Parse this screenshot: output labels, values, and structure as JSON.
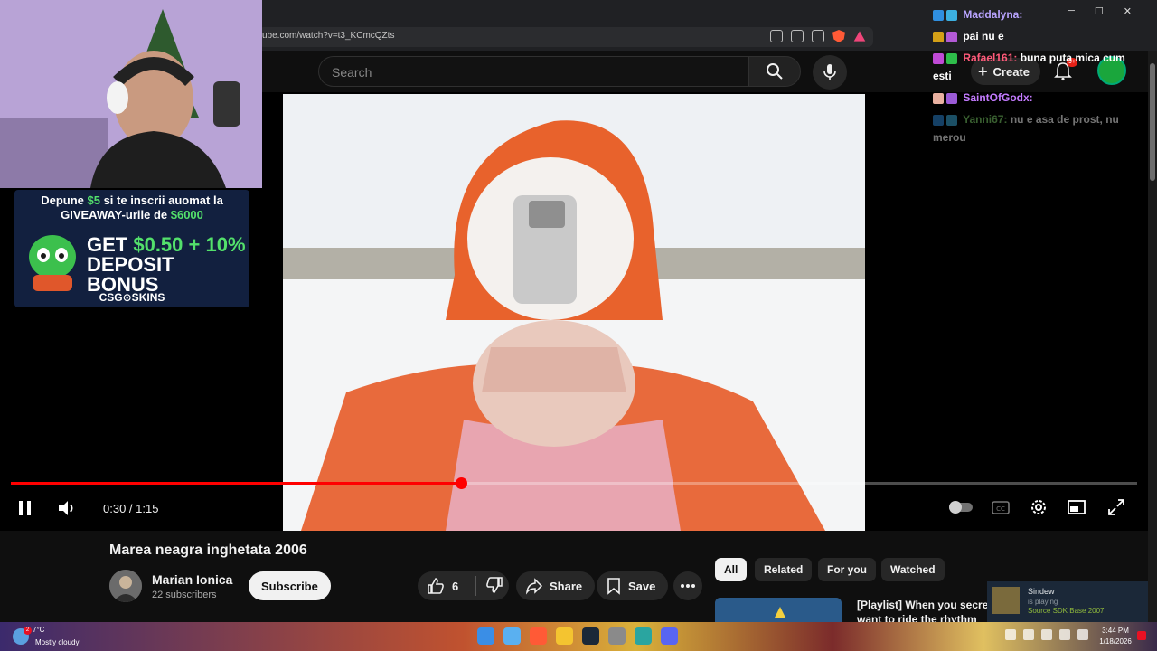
{
  "browser": {
    "url": "ube.com/watch?v=t3_KCmcQZts"
  },
  "masthead": {
    "search_placeholder": "Search",
    "create_label": "Create",
    "notif_count": "9+"
  },
  "player": {
    "time": "0:30 / 1:15",
    "progress": 0.4,
    "icons": [
      "pause-icon",
      "volume-icon",
      "autoplay-toggle",
      "cc-icon",
      "settings-icon",
      "miniplayer-icon",
      "fullscreen-icon"
    ]
  },
  "overlay": {
    "ad_line1_pre": "Depune ",
    "ad_line1_amount": "$5",
    "ad_line1_post": " si te inscrii auomat la",
    "ad_line2_pre": "GIVEAWAY-urile de ",
    "ad_line2_amount": "$6000",
    "ad_big1": "GET ",
    "ad_big1_amount": "$0.50 + 10%",
    "ad_big2": "DEPOSIT BONUS",
    "ad_logo": "CSG⊙SKINS"
  },
  "chat": [
    {
      "user": "Maddalyna:",
      "msg": "",
      "color": "#b9a4ff",
      "faded": false
    },
    {
      "user": "",
      "msg": "pai nu e",
      "color": "#ff5a7a",
      "faded": false
    },
    {
      "user": "Rafael161:",
      "msg": "buna puta mica cum esti",
      "color": "#ff5a7a",
      "faded": false
    },
    {
      "user": "SaintOfGodx:",
      "msg": "",
      "color": "#c47bff",
      "faded": false
    },
    {
      "user": "Yanni67:",
      "msg": "nu e asa de prost, nu merou",
      "color": "#7fd36b",
      "faded": true
    }
  ],
  "video": {
    "title": "Marea neagra inghetata 2006",
    "channel": "Marian Ionica",
    "subscribers": "22 subscribers",
    "subscribe_label": "Subscribe",
    "likes": "6",
    "share_label": "Share",
    "save_label": "Save"
  },
  "chips": [
    "All",
    "Related",
    "For you",
    "Watched"
  ],
  "recommendation": {
    "title": "[Playlist] When you secret want to ride the rhythm"
  },
  "toast": {
    "name": "Sindew",
    "status": "is playing",
    "game": "Source SDK Base 2007"
  },
  "taskbar": {
    "temp": "7°C",
    "weather": "Mostly cloudy",
    "weather_badge": "2",
    "time": "3:44 PM",
    "date": "1/18/2026"
  },
  "colors": {
    "accent_red": "#ff0000",
    "background": "#0f0f0f",
    "chip_bg": "#272727"
  }
}
